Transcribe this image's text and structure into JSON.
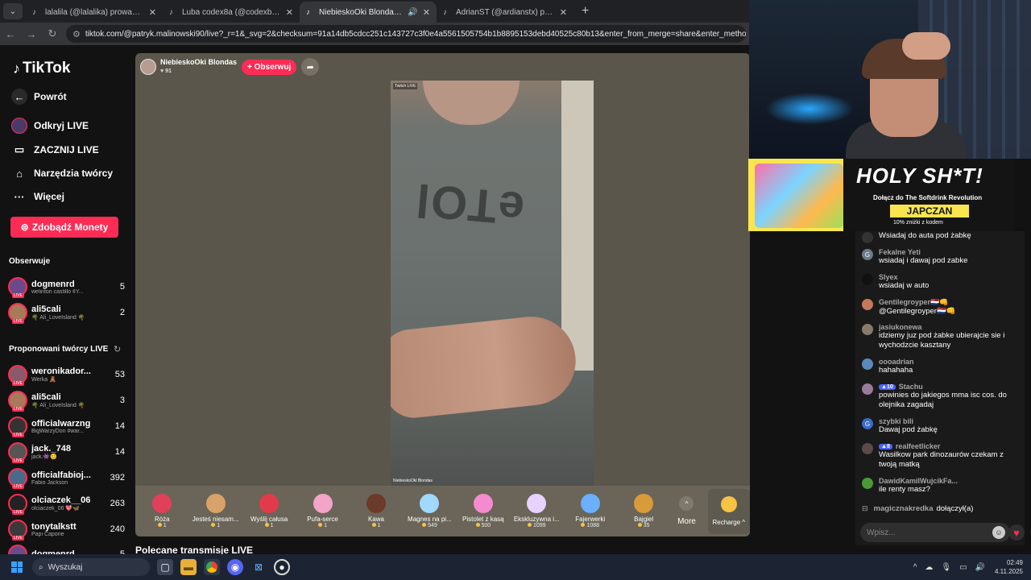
{
  "browser": {
    "tabs": [
      {
        "title": "lalalila (@lalalika) prowadzi LIVE",
        "active": false,
        "audio": false
      },
      {
        "title": "Luba codex8a (@codexba369)",
        "active": false,
        "audio": false
      },
      {
        "title": "NiebieskoOki Blondas (@patryk...",
        "active": true,
        "audio": true
      },
      {
        "title": "AdrianST (@ardianstx) prowadzi",
        "active": false,
        "audio": false
      }
    ],
    "url": "tiktok.com/@patryk.malinowski90/live?_r=1&_svg=2&checksum=91a14db5cdcc251c143727c3f0e4a5561505754b1b8895153debd40525c80b13&enter_from_merge=share&enter_method=share&sec_us"
  },
  "sidebar": {
    "logo": "TikTok",
    "nav": [
      {
        "label": "Powrót",
        "icon": "back-arrow-icon"
      },
      {
        "label": "Odkryj LIVE",
        "icon": "live-avatar-icon"
      },
      {
        "label": "ZACZNIJ LIVE",
        "icon": "camera-icon"
      },
      {
        "label": "Narzędzia twórcy",
        "icon": "home-icon"
      },
      {
        "label": "Więcej",
        "icon": "more-dots-icon"
      }
    ],
    "coins_button": "Zdobądź Monety",
    "following_header": "Obserwuje",
    "following": [
      {
        "name": "dogmenrd",
        "sub": "welinton castillo ¢Y...",
        "count": "5",
        "color": "#6a4a8a"
      },
      {
        "name": "ali5cali",
        "sub": "🌴 Ali_LoveIsland 🌴",
        "count": "2",
        "color": "#a67a5a"
      }
    ],
    "suggested_header": "Proponowani twórcy LIVE",
    "suggested": [
      {
        "name": "weronikador...",
        "sub": "Werka 🧸",
        "count": "53",
        "color": "#8a5a6a"
      },
      {
        "name": "ali5cali",
        "sub": "🌴 Ali_LoveIsland 🌴",
        "count": "3",
        "color": "#a67a5a"
      },
      {
        "name": "officialwarzng",
        "sub": "BigWarzyDon #war...",
        "count": "14",
        "color": "#333333"
      },
      {
        "name": "jack._748",
        "sub": "jack.👾😊",
        "count": "14",
        "color": "#555555"
      },
      {
        "name": "officialfabioj...",
        "sub": "Fabio Jackson",
        "count": "392",
        "color": "#4a6a8a"
      },
      {
        "name": "olciaczek__06",
        "sub": "olciaczek_06 💖🦋",
        "count": "263",
        "color": "#222222"
      },
      {
        "name": "tonytalkstt",
        "sub": "Papi Capone",
        "count": "240",
        "color": "#3a3a3a"
      },
      {
        "name": "dogmenrd",
        "sub": "",
        "count": "5",
        "color": "#6a4a8a"
      }
    ]
  },
  "live": {
    "host_name": "NiebieskoOki Blondas",
    "likes": "91",
    "follow_label": "+ Obserwuj",
    "watermark_top": "Twitch LIVE",
    "watermark_bottom": "NiebieskoOki Blondas",
    "shirt_text": "eTOl",
    "gifts": [
      {
        "name": "Róża",
        "price": "1",
        "color": "#e0405a"
      },
      {
        "name": "Jesteś niesam...",
        "price": "1",
        "color": "#d9a26a"
      },
      {
        "name": "Wyślij całusa",
        "price": "1",
        "color": "#e23a4a"
      },
      {
        "name": "Pufa-serce",
        "price": "1",
        "color": "#f3a4c8"
      },
      {
        "name": "Kawa",
        "price": "1",
        "color": "#6a3a2a"
      },
      {
        "name": "Magnes na pi...",
        "price": "549",
        "color": "#a0d8ff"
      },
      {
        "name": "Pistolet z kasą",
        "price": "500",
        "color": "#f58ad0"
      },
      {
        "name": "Ekskluzywna i...",
        "price": "1099",
        "color": "#e8d2ff"
      },
      {
        "name": "Fajerwerki",
        "price": "1088",
        "color": "#6ab0ff"
      },
      {
        "name": "Bajgiel",
        "price": "35",
        "color": "#d99a3a"
      }
    ],
    "more_label": "More",
    "recharge_label": "Recharge"
  },
  "section_title": "Polecane transmisje LIVE",
  "banner": {
    "headline": "HOLY SH*T!",
    "line1": "Dołącz do The Softdrink Revolution",
    "code": "JAPCZAN",
    "line2": "10% zniżki z kodem"
  },
  "chat": {
    "messages": [
      {
        "user": "",
        "text": "Wsiadaj do auta pod żabkę",
        "avatar": "#333333",
        "initial": "",
        "badge": ""
      },
      {
        "user": "Fekalne Yeti",
        "text": "wsiadaj i dawaj pod zabke",
        "avatar": "#6a7a8a",
        "initial": "G",
        "badge": ""
      },
      {
        "user": "Slyex",
        "text": "wsiadaj w auto",
        "avatar": "#111111",
        "initial": "",
        "badge": ""
      },
      {
        "user": "Gentilegroyper🇳🇱👊",
        "text": "@Gentilegroyper🇳🇱👊",
        "avatar": "#c47a5a",
        "initial": "",
        "badge": ""
      },
      {
        "user": "jasiukonewa",
        "text": "idziemy juz pod żabke ubierajcie sie i wychodzcie kasztany",
        "avatar": "#8a7a6a",
        "initial": "",
        "badge": ""
      },
      {
        "user": "oooadrian",
        "text": "hahahaha",
        "avatar": "#5a8aba",
        "initial": "",
        "badge": ""
      },
      {
        "user": "Stachu",
        "text": "powinies do jakiegos mma isc cos. do olejnika zagadaj",
        "avatar": "#9a7a9a",
        "initial": "",
        "badge": "10"
      },
      {
        "user": "szybki bili",
        "text": "Dawaj pod żabkę",
        "avatar": "#3a6ac4",
        "initial": "G",
        "badge": ""
      },
      {
        "user": "realfeetlicker",
        "text": "Wasilkow park dinozaurów czekam z twoją matką",
        "avatar": "#5a4a4a",
        "initial": "",
        "badge": "8"
      },
      {
        "user": "DawidKamilWujcikFa...",
        "text": "ile renty masz?",
        "avatar": "#4a9a3a",
        "initial": "",
        "badge": ""
      }
    ],
    "joined_user": "magicznakredka",
    "joined_action": "dołączył(a)",
    "input_placeholder": "Wpisz..."
  },
  "taskbar": {
    "search_placeholder": "Wyszukaj",
    "time": "02:49",
    "date": "4.11.2025"
  }
}
